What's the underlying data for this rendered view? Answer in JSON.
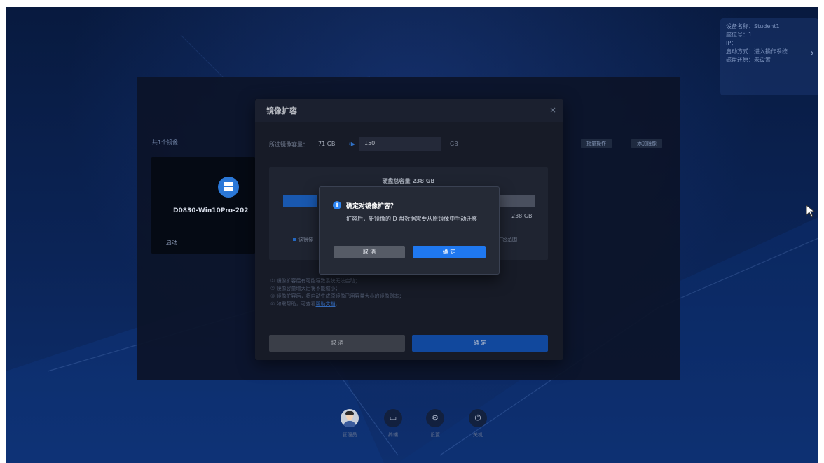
{
  "device_info": {
    "rows": [
      "设备名称：Student1",
      "座位号：1",
      "IP：",
      "启动方式：进入操作系统",
      "磁盘还原：未设置"
    ]
  },
  "manager": {
    "image_count": "共1个镜像",
    "batch_label": "批量操作",
    "add_label": "添加镜像",
    "card": {
      "name": "D0830-Win10Pro-202",
      "start_label": "启动"
    }
  },
  "expand_dialog": {
    "title": "镜像扩容",
    "close": "×",
    "cap_label": "所选镜像容量：",
    "current": "71 GB",
    "new_value": "150",
    "unit": "GB",
    "disk_total": "硬盘总容量 238 GB",
    "max_label": "238 GB",
    "legend_image": "该镜像",
    "legend_range": "扩容范围",
    "notes": [
      "① 镜像扩容后有可能导致系统无法启动；",
      "② 镜像容量增大后将不能缩小；",
      "③ 镜像扩容后，将自动生成原镜像已用容量大小的镜像副本；",
      "④ 如需帮助，可查看"
    ],
    "help_link": "帮助文档",
    "cancel": "取 消",
    "ok": "确 定"
  },
  "confirm": {
    "title": "确定对镜像扩容？",
    "message": "扩容后，新镜像的 D 盘数据需要从原镜像中手动迁移",
    "cancel": "取 消",
    "ok": "确 定"
  },
  "dock": [
    {
      "label": "管理员",
      "icon": "avatar-icon"
    },
    {
      "label": "终端",
      "icon": "terminal-icon"
    },
    {
      "label": "设置",
      "icon": "gear-icon"
    },
    {
      "label": "关机",
      "icon": "power-icon"
    }
  ]
}
